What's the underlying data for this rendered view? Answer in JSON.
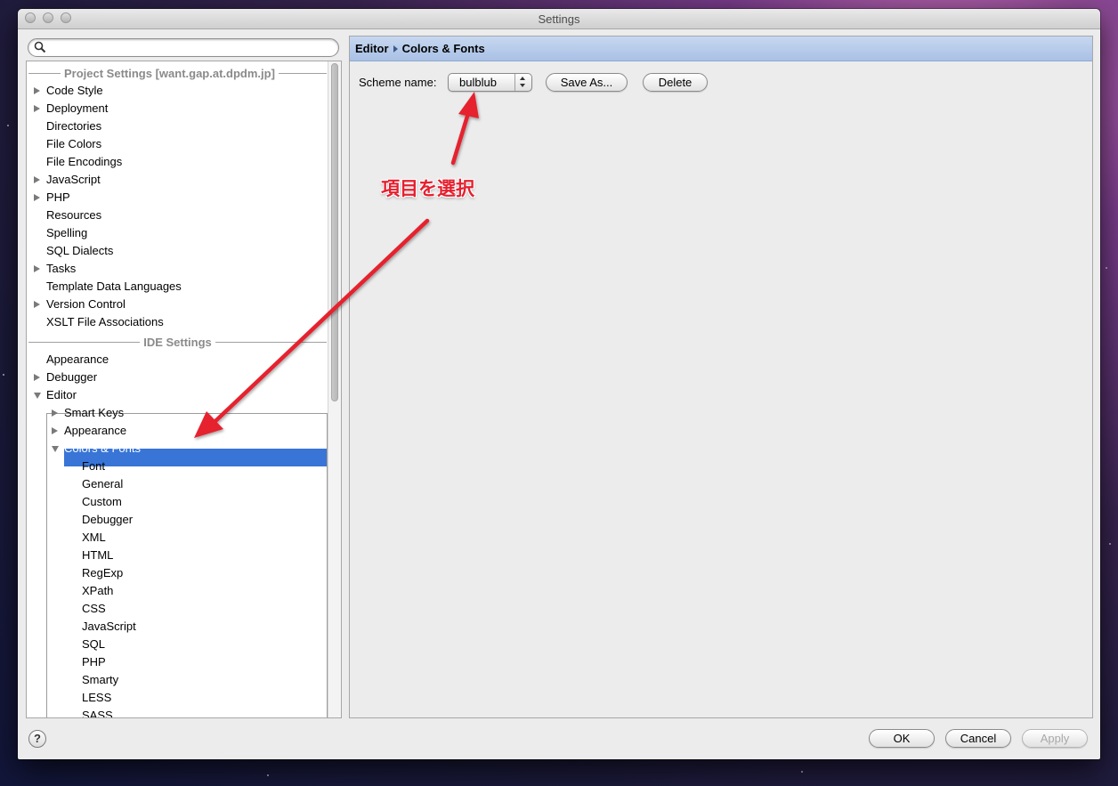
{
  "window": {
    "title": "Settings"
  },
  "search": {
    "placeholder": ""
  },
  "tree": {
    "project_header": "Project Settings [want.gap.at.dpdm.jp]",
    "project_items": [
      {
        "label": "Code Style",
        "expandable": true
      },
      {
        "label": "Deployment",
        "expandable": true
      },
      {
        "label": "Directories",
        "expandable": false
      },
      {
        "label": "File Colors",
        "expandable": false
      },
      {
        "label": "File Encodings",
        "expandable": false
      },
      {
        "label": "JavaScript",
        "expandable": true
      },
      {
        "label": "PHP",
        "expandable": true
      },
      {
        "label": "Resources",
        "expandable": false
      },
      {
        "label": "Spelling",
        "expandable": false
      },
      {
        "label": "SQL Dialects",
        "expandable": false
      },
      {
        "label": "Tasks",
        "expandable": true
      },
      {
        "label": "Template Data Languages",
        "expandable": false
      },
      {
        "label": "Version Control",
        "expandable": true
      },
      {
        "label": "XSLT File Associations",
        "expandable": false
      }
    ],
    "ide_header": "IDE Settings",
    "ide_items": [
      {
        "label": "Appearance",
        "expandable": false
      },
      {
        "label": "Debugger",
        "expandable": true
      },
      {
        "label": "Editor",
        "expandable": true,
        "expanded": true
      }
    ],
    "editor_children": [
      {
        "label": "Smart Keys",
        "expandable": true
      },
      {
        "label": "Appearance",
        "expandable": true
      },
      {
        "label": "Colors & Fonts",
        "expandable": true,
        "expanded": true,
        "selected": true
      }
    ],
    "colors_fonts_children": [
      "Font",
      "General",
      "Custom",
      "Debugger",
      "XML",
      "HTML",
      "RegExp",
      "XPath",
      "CSS",
      "JavaScript",
      "SQL",
      "PHP",
      "Smarty",
      "LESS",
      "SASS"
    ]
  },
  "content": {
    "breadcrumb": [
      "Editor",
      "Colors & Fonts"
    ],
    "scheme_label": "Scheme name:",
    "scheme_value": "bulblub",
    "save_as_label": "Save As...",
    "delete_label": "Delete"
  },
  "footer": {
    "help_label": "?",
    "ok_label": "OK",
    "cancel_label": "Cancel",
    "apply_label": "Apply",
    "apply_enabled": false
  },
  "annotation": {
    "text": "項目を選択",
    "color": "#e5202f"
  },
  "colors": {
    "selection": "#3875d7",
    "breadcrumb_bg": "#b7cbea",
    "window_bg": "#ececec"
  }
}
